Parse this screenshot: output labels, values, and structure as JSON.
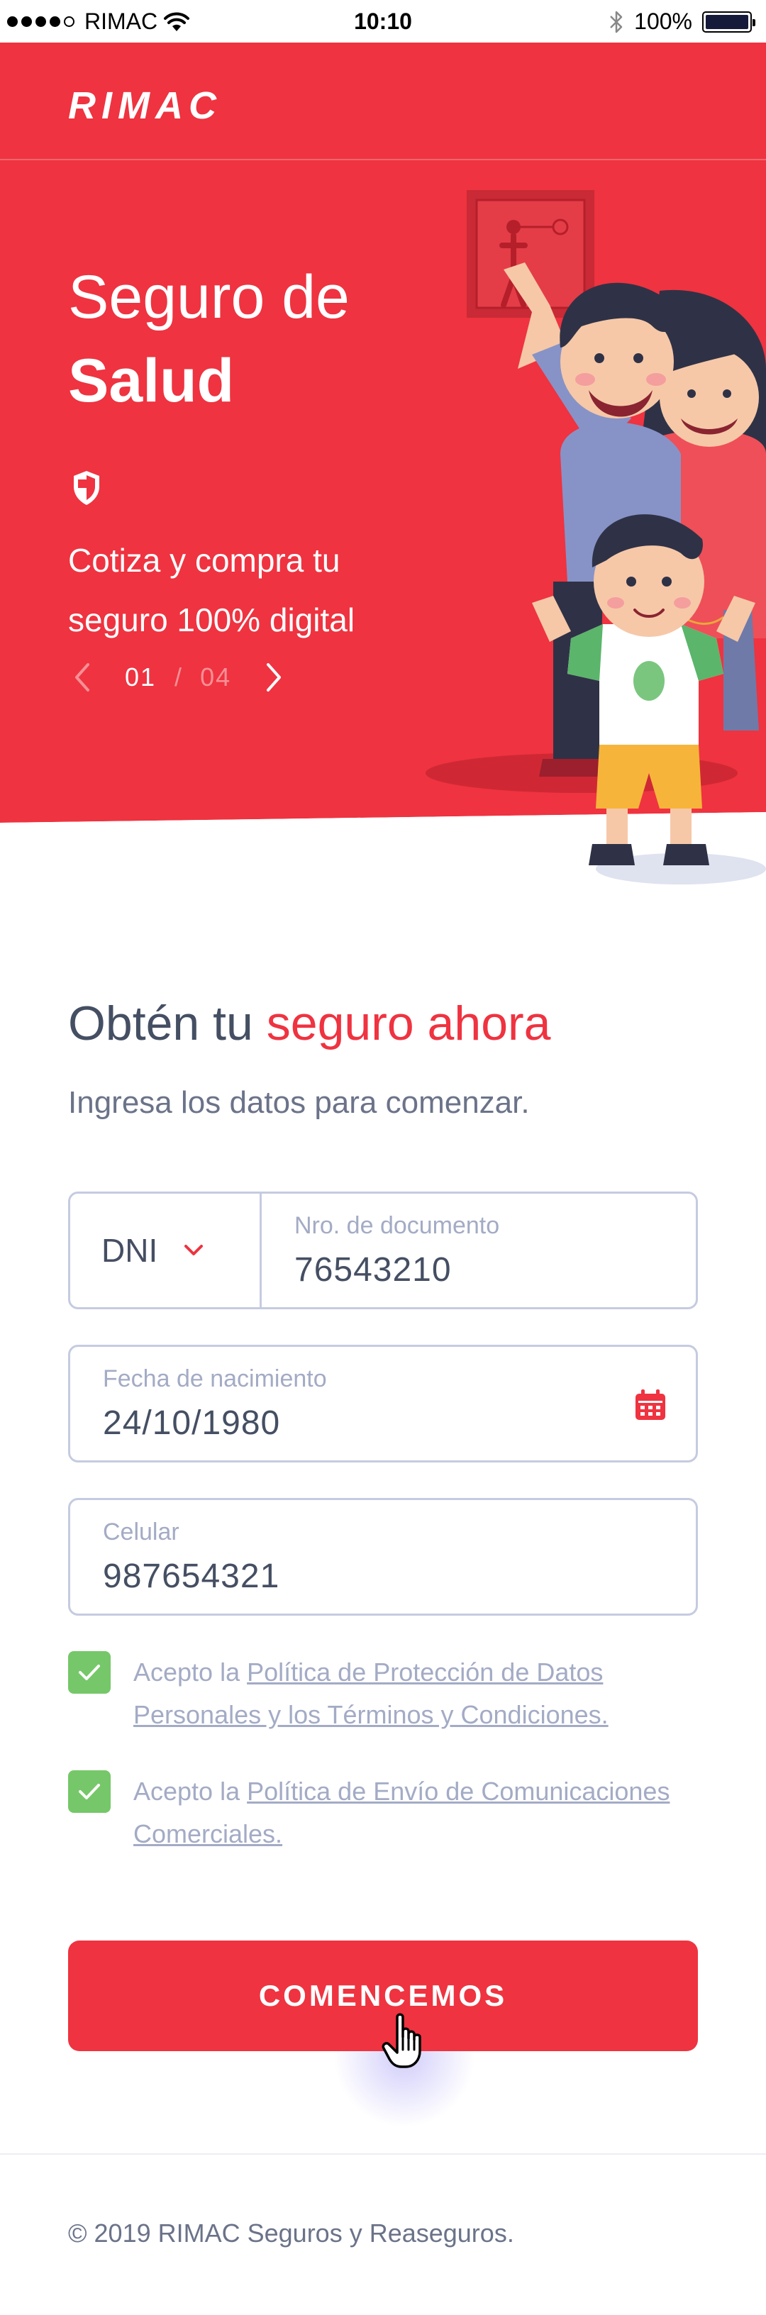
{
  "status_bar": {
    "carrier": "RIMAC",
    "time": "10:10",
    "battery": "100%"
  },
  "header": {
    "logo": "RIMAC"
  },
  "hero": {
    "title_line1": "Seguro de",
    "title_line2": "Salud",
    "subtitle": "Cotiza y compra tu seguro 100% digital",
    "slider": {
      "current": "01",
      "separator": "/",
      "total": "04"
    },
    "icons": [
      "shield-icon",
      "chevron-left-icon",
      "chevron-right-icon"
    ]
  },
  "form": {
    "title_prefix": "Obtén tu ",
    "title_accent": "seguro ahora",
    "subtitle": "Ingresa los datos para comenzar.",
    "document": {
      "type": "DNI",
      "label": "Nro. de documento",
      "value": "76543210"
    },
    "birthdate": {
      "label": "Fecha de nacimiento",
      "value": "24/10/1980"
    },
    "phone": {
      "label": "Celular",
      "value": "987654321"
    },
    "consents": [
      {
        "prefix": "Acepto la ",
        "link": "Política de Protección de Datos Personales y los Términos y Condiciones.",
        "checked": true
      },
      {
        "prefix": "Acepto la ",
        "link": "Política de Envío de Comunicaciones Comerciales.",
        "checked": true
      }
    ],
    "submit_label": "COMENCEMOS"
  },
  "footer": {
    "copyright": "© 2019 RIMAC Seguros y Reaseguros."
  },
  "colors": {
    "brand_red": "#ef3340",
    "text_dark": "#454f63",
    "border": "#c5cbe0",
    "check_green": "#76c769"
  }
}
